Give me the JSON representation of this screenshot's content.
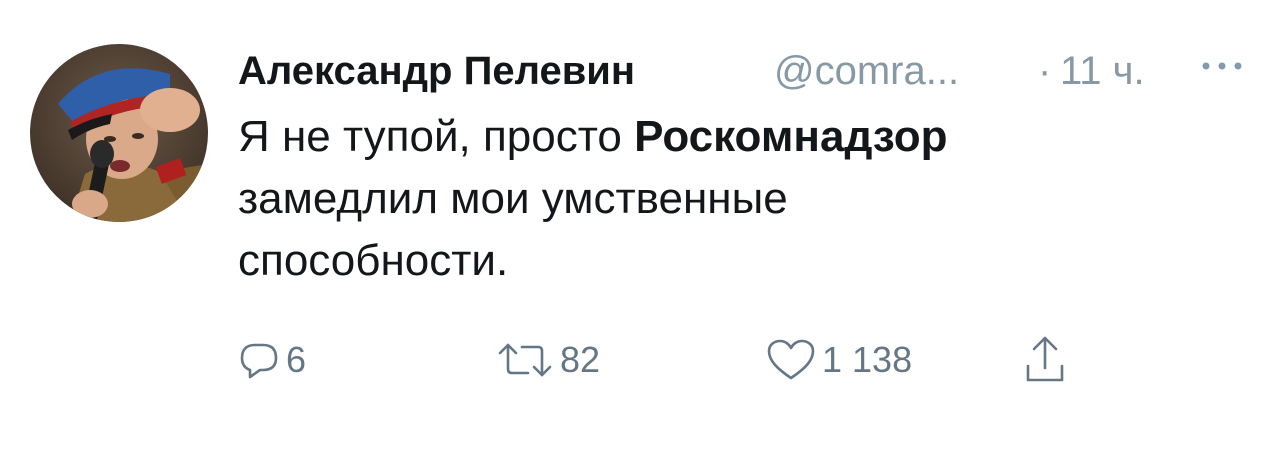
{
  "tweet": {
    "author": {
      "display_name": "Александр Пелевин",
      "handle": "@comra...",
      "avatar": "profile-photo"
    },
    "separator": "·",
    "time": "11 ч.",
    "more_icon": "more-horizontal-icon",
    "text": {
      "part1": "Я не тупой, просто ",
      "bold": "Роскомнадзор",
      "part2": "замедлил мои умственные",
      "part3": "способности."
    },
    "actions": {
      "reply": {
        "icon": "reply-icon",
        "count": "6"
      },
      "retweet": {
        "icon": "retweet-icon",
        "count": "82"
      },
      "like": {
        "icon": "heart-icon",
        "count": "1 138"
      },
      "share": {
        "icon": "share-icon"
      }
    },
    "colors": {
      "text": "#14171a",
      "secondary": "#8899a6",
      "action": "#657786"
    }
  }
}
